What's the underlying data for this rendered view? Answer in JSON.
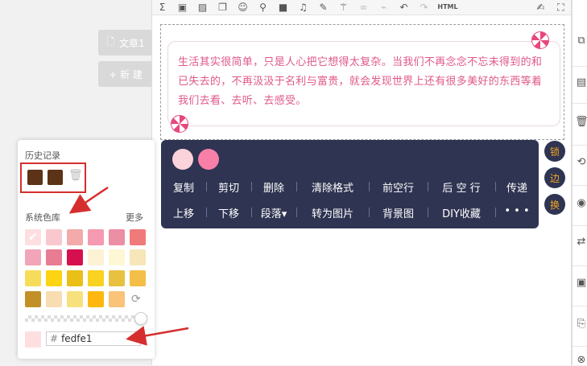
{
  "left": {
    "article_label": "文章1",
    "article_icon": "doc-icon",
    "new_label": "+ 新 建"
  },
  "toolbar": {
    "icons": [
      "sigma-icon",
      "image-icon",
      "image-icon",
      "square-icon",
      "emoji-icon",
      "map-pin-icon",
      "video-icon",
      "music-icon",
      "brush-icon",
      "magic-wand-icon",
      "link-icon",
      "unlink-icon",
      "undo-icon",
      "redo-icon"
    ],
    "html_label": "HTML"
  },
  "content": {
    "text": "生活其实很简单，只是人心把它想得太复杂。当我们不再念念不忘未得到的和已失去的，不再汲汲于名利与富贵，就会发现世界上还有很多美好的东西等着我们去看、去听、去感受。"
  },
  "popup": {
    "colors": [
      "#fbd3da",
      "#f77fa8"
    ],
    "row1": [
      "复制",
      "剪切",
      "删除",
      "清除格式",
      "前空行",
      "后 空 行",
      "传递"
    ],
    "row2": [
      "上移",
      "下移",
      "段落▾",
      "转为图片",
      "背景图",
      "DIY收藏",
      "• • •"
    ]
  },
  "side_circles": [
    "锁",
    "边",
    "换"
  ],
  "picker": {
    "history_title": "历史记录",
    "history_colors": [
      "#5c3317",
      "#5c3317"
    ],
    "system_title": "系统色库",
    "more_label": "更多",
    "swatches": [
      [
        "#fedfe1",
        "#f9c8cf",
        "#f2aaaa",
        "#f59ab0",
        "#ec8ea4",
        "#f07a7a"
      ],
      [
        "#f2a5b8",
        "#e77c93",
        "#d6104e",
        "#fbf3d4",
        "#fdf7d5",
        "#f6e6b8"
      ],
      [
        "#f7dc5a",
        "#fcd412",
        "#e9bf18",
        "#f9d222",
        "#e8c141",
        "#f3bf48"
      ],
      [
        "#c19027",
        "#f8dcb2",
        "#f7e17d",
        "#fdb70f",
        "#f9c37a"
      ]
    ],
    "hex_value": "fedfe1",
    "current_color": "#fedfe1"
  }
}
